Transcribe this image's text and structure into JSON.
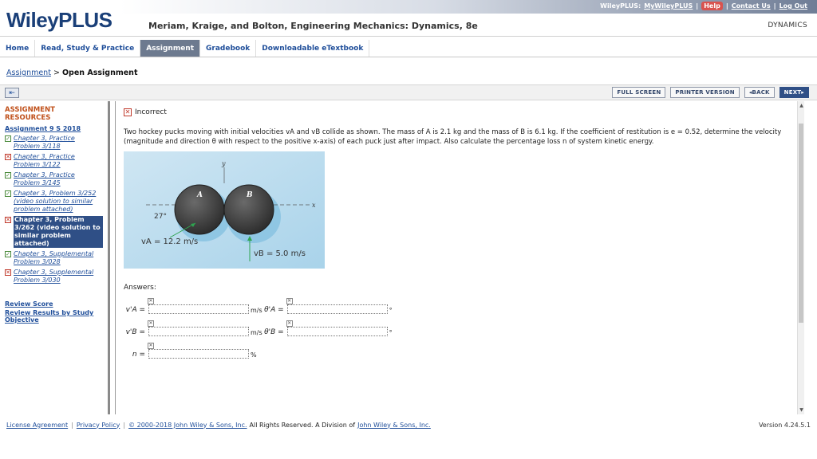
{
  "header": {
    "logo": "WileyPLUS",
    "book_title": "Meriam, Kraige, and Bolton, Engineering Mechanics: Dynamics, 8e",
    "top_label": "WileyPLUS:",
    "my_link": "MyWileyPLUS",
    "help": "Help",
    "contact": "Contact Us",
    "logout": "Log Out",
    "course": "DYNAMICS"
  },
  "nav": {
    "tabs": [
      "Home",
      "Read, Study & Practice",
      "Assignment",
      "Gradebook",
      "Downloadable eTextbook"
    ],
    "active_index": 2
  },
  "breadcrumb": {
    "parent": "Assignment",
    "separator": ">",
    "current": "Open Assignment"
  },
  "toolbar": {
    "full_screen": "FULL SCREEN",
    "printer": "PRINTER VERSION",
    "back": "◂BACK",
    "next": "NEXT▸"
  },
  "sidebar": {
    "heading": "ASSIGNMENT RESOURCES",
    "assignment": "Assignment 9 S 2018",
    "items": [
      {
        "status": "ok",
        "label": "Chapter 3, Practice Problem 3/118"
      },
      {
        "status": "bad",
        "label": "Chapter 3, Practice Problem 3/122"
      },
      {
        "status": "ok",
        "label": "Chapter 3, Practice Problem 3/145"
      },
      {
        "status": "ok",
        "label": "Chapter 3, Problem 3/252 (video solution to similar problem attached)"
      },
      {
        "status": "bad",
        "label": "Chapter 3, Problem 3/262 (video solution to similar problem attached)",
        "active": true
      },
      {
        "status": "ok",
        "label": "Chapter 3, Supplemental Problem 3/028"
      },
      {
        "status": "bad",
        "label": "Chapter 3, Supplemental Problem 3/030"
      }
    ],
    "review_score": "Review Score",
    "review_results": "Review Results by Study Objective"
  },
  "content": {
    "status": "Incorrect",
    "problem": "Two hockey pucks moving with initial velocities vA and vB collide as shown. The mass of A is 2.1 kg and the mass of B is 6.1 kg. If the coefficient of restitution is e = 0.52, determine the velocity (magnitude and direction θ with respect to the positive x-axis) of each puck just after impact. Also calculate the percentage loss n of system kinetic energy.",
    "figure": {
      "label_a": "A",
      "label_b": "B",
      "axis_x": "x",
      "axis_y": "y",
      "angle": "27°",
      "va": "vA = 12.2 m/s",
      "vb": "vB = 5.0 m/s"
    },
    "answers_label": "Answers:",
    "answers": [
      {
        "var": "v'A =",
        "unit": "m/s",
        "var2": "θ'A =",
        "unit2": "°"
      },
      {
        "var": "v'B =",
        "unit": "m/s",
        "var2": "θ'B =",
        "unit2": "°"
      },
      {
        "var": "n =",
        "unit": "%"
      }
    ]
  },
  "footer": {
    "license": "License Agreement",
    "privacy": "Privacy Policy",
    "copyright": "© 2000-2018 John Wiley & Sons, Inc.",
    "rights": "All Rights Reserved. A Division of",
    "company": "John Wiley & Sons, Inc.",
    "version": "Version 4.24.5.1"
  }
}
